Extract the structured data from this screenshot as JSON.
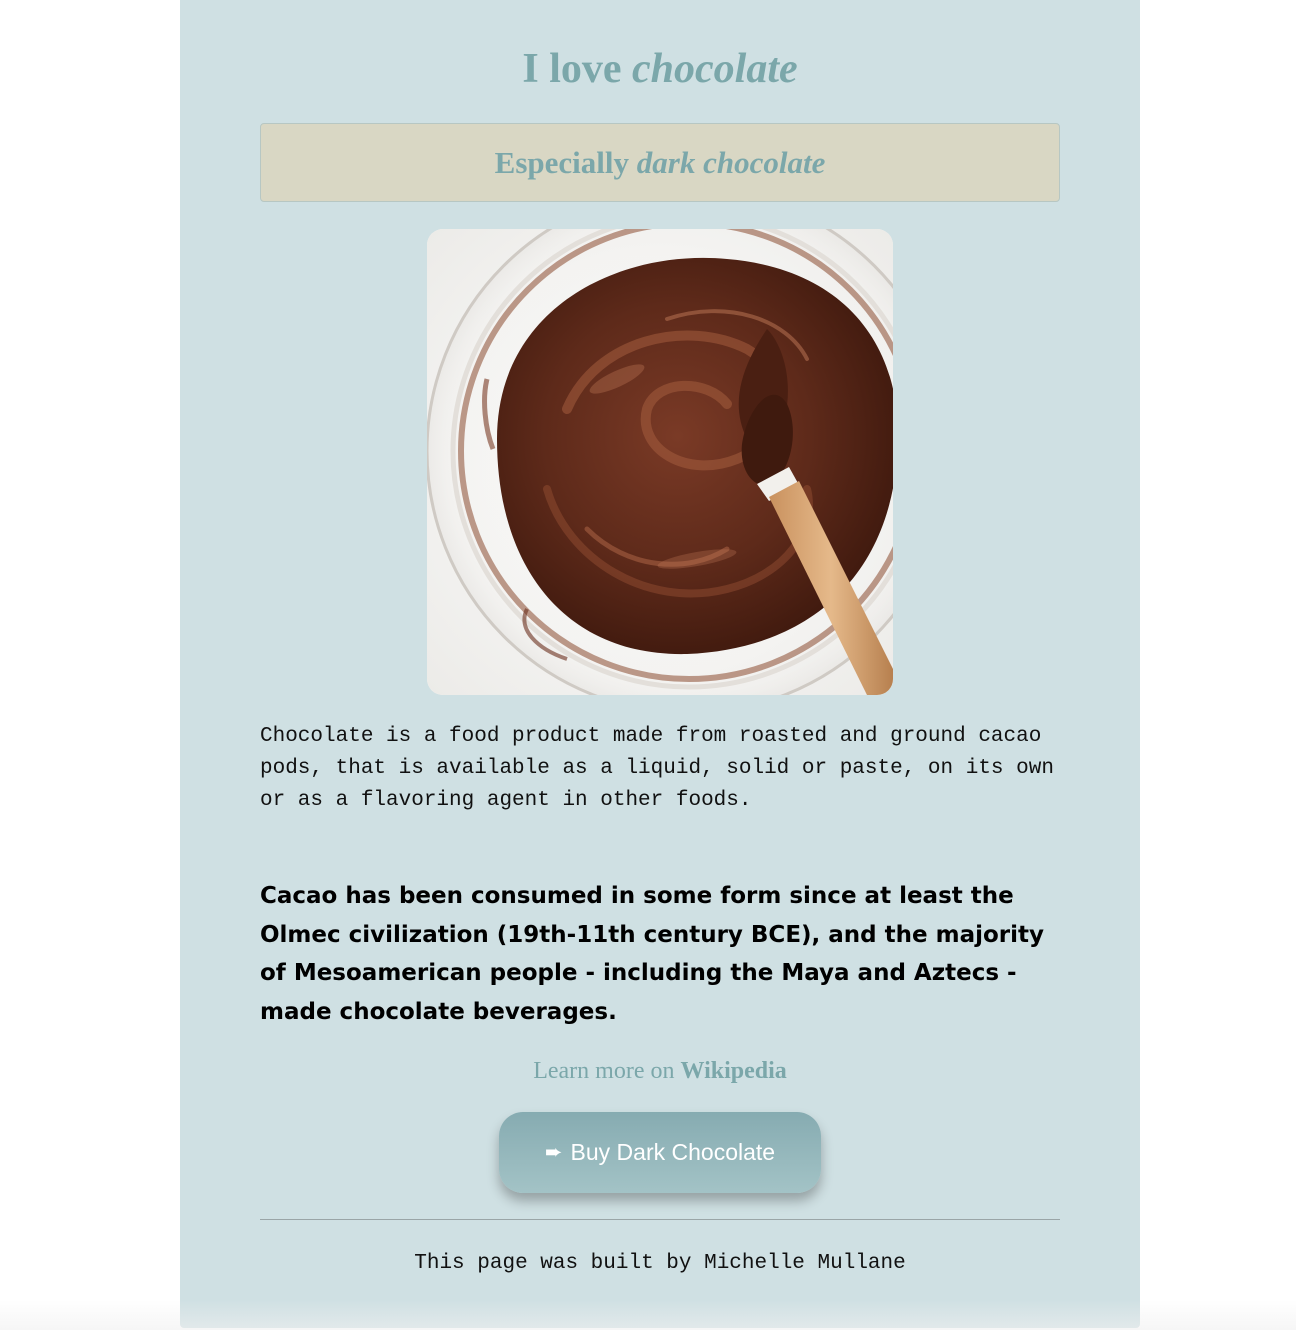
{
  "page": {
    "title_plain": "I love ",
    "title_em": "chocolate",
    "subtitle_plain": "Especially ",
    "subtitle_em": "dark chocolate"
  },
  "image": {
    "alt": "Melted dark chocolate in a glass bowl with a spatula"
  },
  "content": {
    "intro": "Chocolate is a food product made from roasted and ground cacao pods, that is available as a liquid, solid or paste, on its own or as a flavoring agent in other foods.",
    "history": "Cacao has been consumed in some form since at least the Olmec civilization (19th-11th century BCE), and the majority of Mesoamerican people - including the Maya and Aztecs - made chocolate beverages."
  },
  "learn_more": {
    "prefix": "Learn more on ",
    "link_label": "Wikipedia"
  },
  "buy_button": {
    "icon": "right-arrow-icon",
    "arrow_glyph": "➨",
    "label": "Buy Dark Chocolate"
  },
  "footer": {
    "text": "This page was built by Michelle Mullane"
  },
  "colors": {
    "container_bg": "#cfe0e3",
    "accent_text": "#7ba7aa",
    "subtitle_bg": "#d9d7c4",
    "button_bg": "#8fb2b7",
    "button_text": "#ffffff"
  }
}
